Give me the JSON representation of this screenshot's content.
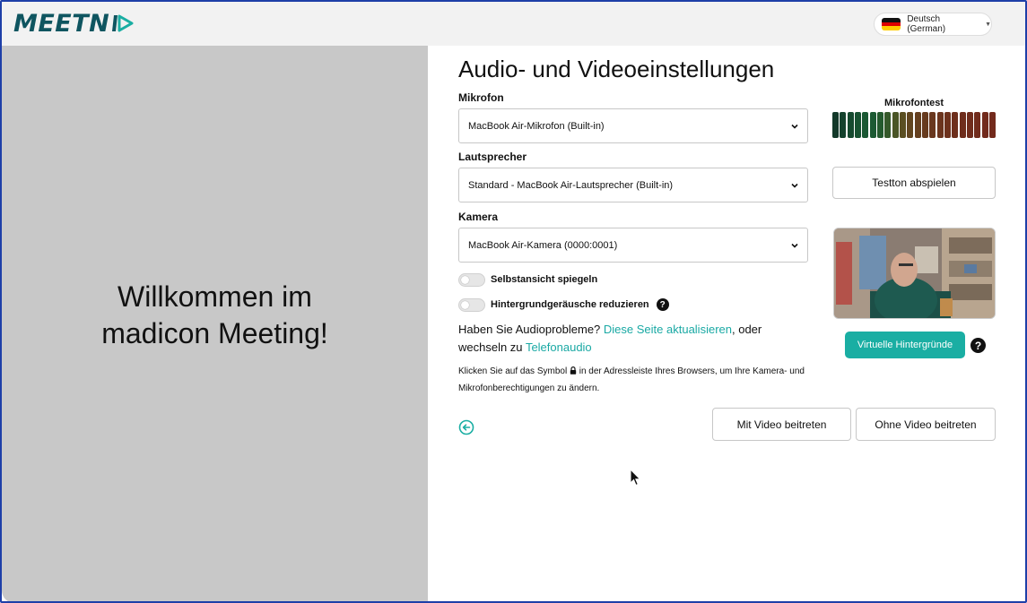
{
  "header": {
    "logo_text": "MEETN",
    "language_label": "Deutsch (German)"
  },
  "welcome": {
    "heading": "Willkommen im madicon Meeting!"
  },
  "settings": {
    "title": "Audio- und Videoeinstellungen",
    "microphone": {
      "label": "Mikrofon",
      "value": "MacBook Air-Mikrofon (Built-in)"
    },
    "speaker": {
      "label": "Lautsprecher",
      "value": "Standard - MacBook Air-Lautsprecher (Built-in)"
    },
    "camera": {
      "label": "Kamera",
      "value": "MacBook Air-Kamera (0000:0001)"
    },
    "mirror_toggle": {
      "label": "Selbstansicht spiegeln",
      "on": false
    },
    "noise_toggle": {
      "label": "Hintergrundgeräusche reduzieren",
      "on": false
    },
    "audio_problem": {
      "prefix": "Haben Sie Audioprobleme?",
      "refresh_link": "Diese Seite aktualisieren",
      "middle": ",  oder wechseln zu",
      "phone_link": "Telefonaudio"
    },
    "hint": {
      "before_icon": "Klicken Sie auf das Symbol",
      "after_icon": "in der Adressleiste Ihres Browsers, um Ihre Kamera- und Mikrofonberechtigungen zu ändern."
    }
  },
  "side": {
    "mic_test_label": "Mikrofontest",
    "mic_level_bars": [
      "#13392a",
      "#14422d",
      "#154a2f",
      "#175231",
      "#1a5833",
      "#1c5a33",
      "#245a2e",
      "#35592a",
      "#4a5526",
      "#5b4f22",
      "#624620",
      "#65401f",
      "#673b1e",
      "#69371e",
      "#6b341d",
      "#6d311c",
      "#6e2f1c",
      "#6f2d1c",
      "#702c1c",
      "#712b1c",
      "#722a1c",
      "#732a1c"
    ],
    "test_tone_button": "Testton abspielen",
    "virtual_bg_button": "Virtuelle Hintergründe",
    "help_symbol": "?"
  },
  "actions": {
    "join_with_video": "Mit Video beitreten",
    "join_without_video": "Ohne Video beitreten"
  },
  "colors": {
    "accent": "#1aaea3",
    "logo": "#0f5560",
    "left_panel": "#c8c8c8",
    "frame": "#1e3fa8"
  }
}
